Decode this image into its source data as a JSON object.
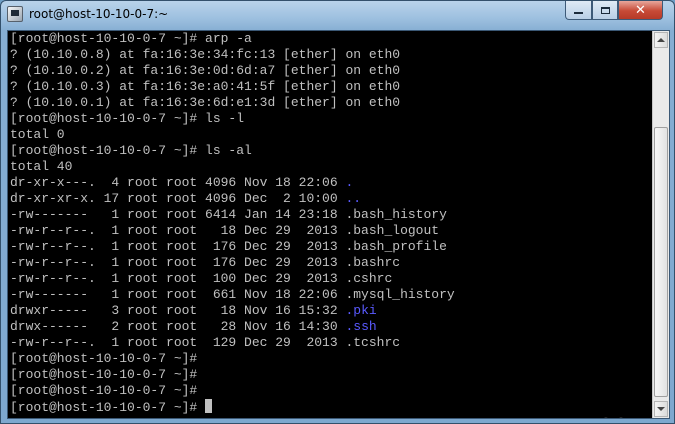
{
  "window": {
    "title": "root@host-10-10-0-7:~",
    "controls": {
      "minimize": "minimize",
      "maximize": "maximize",
      "close": "✕"
    }
  },
  "terminal": {
    "lines": [
      [
        {
          "t": "[root@host-10-10-0-7 ~]# arp -a"
        }
      ],
      [
        {
          "t": "? (10.10.0.8) at fa:16:3e:34:fc:13 [ether] on eth0"
        }
      ],
      [
        {
          "t": "? (10.10.0.2) at fa:16:3e:0d:6d:a7 [ether] on eth0"
        }
      ],
      [
        {
          "t": "? (10.10.0.3) at fa:16:3e:a0:41:5f [ether] on eth0"
        }
      ],
      [
        {
          "t": "? (10.10.0.1) at fa:16:3e:6d:e1:3d [ether] on eth0"
        }
      ],
      [
        {
          "t": "[root@host-10-10-0-7 ~]# ls -l"
        }
      ],
      [
        {
          "t": "total 0"
        }
      ],
      [
        {
          "t": "[root@host-10-10-0-7 ~]# ls -al"
        }
      ],
      [
        {
          "t": "total 40"
        }
      ],
      [
        {
          "t": "dr-xr-x---.  4 root root 4096 Nov 18 22:06 "
        },
        {
          "t": ".",
          "c": "blue"
        }
      ],
      [
        {
          "t": "dr-xr-xr-x. 17 root root 4096 Dec  2 10:00 "
        },
        {
          "t": "..",
          "c": "blue"
        }
      ],
      [
        {
          "t": "-rw-------   1 root root 6414 Jan 14 23:18 .bash_history"
        }
      ],
      [
        {
          "t": "-rw-r--r--.  1 root root   18 Dec 29  2013 .bash_logout"
        }
      ],
      [
        {
          "t": "-rw-r--r--.  1 root root  176 Dec 29  2013 .bash_profile"
        }
      ],
      [
        {
          "t": "-rw-r--r--.  1 root root  176 Dec 29  2013 .bashrc"
        }
      ],
      [
        {
          "t": "-rw-r--r--.  1 root root  100 Dec 29  2013 .cshrc"
        }
      ],
      [
        {
          "t": "-rw-------   1 root root  661 Nov 18 22:06 .mysql_history"
        }
      ],
      [
        {
          "t": "drwxr-----   3 root root   18 Nov 16 15:32 "
        },
        {
          "t": ".pki",
          "c": "blue"
        }
      ],
      [
        {
          "t": "drwx------   2 root root   28 Nov 16 14:30 "
        },
        {
          "t": ".ssh",
          "c": "blue"
        }
      ],
      [
        {
          "t": "-rw-r--r--.  1 root root  129 Dec 29  2013 .tcshrc"
        }
      ],
      [
        {
          "t": "[root@host-10-10-0-7 ~]#"
        }
      ],
      [
        {
          "t": "[root@host-10-10-0-7 ~]#"
        }
      ],
      [
        {
          "t": "[root@host-10-10-0-7 ~]#"
        }
      ],
      [
        {
          "t": "[root@host-10-10-0-7 ~]# "
        },
        {
          "cursor": true
        }
      ]
    ]
  },
  "watermark": "www.wooyun.org",
  "colors": {
    "terminal_bg": "#000000",
    "terminal_fg": "#c0c0c0",
    "dir_blue": "#5a5aff"
  }
}
